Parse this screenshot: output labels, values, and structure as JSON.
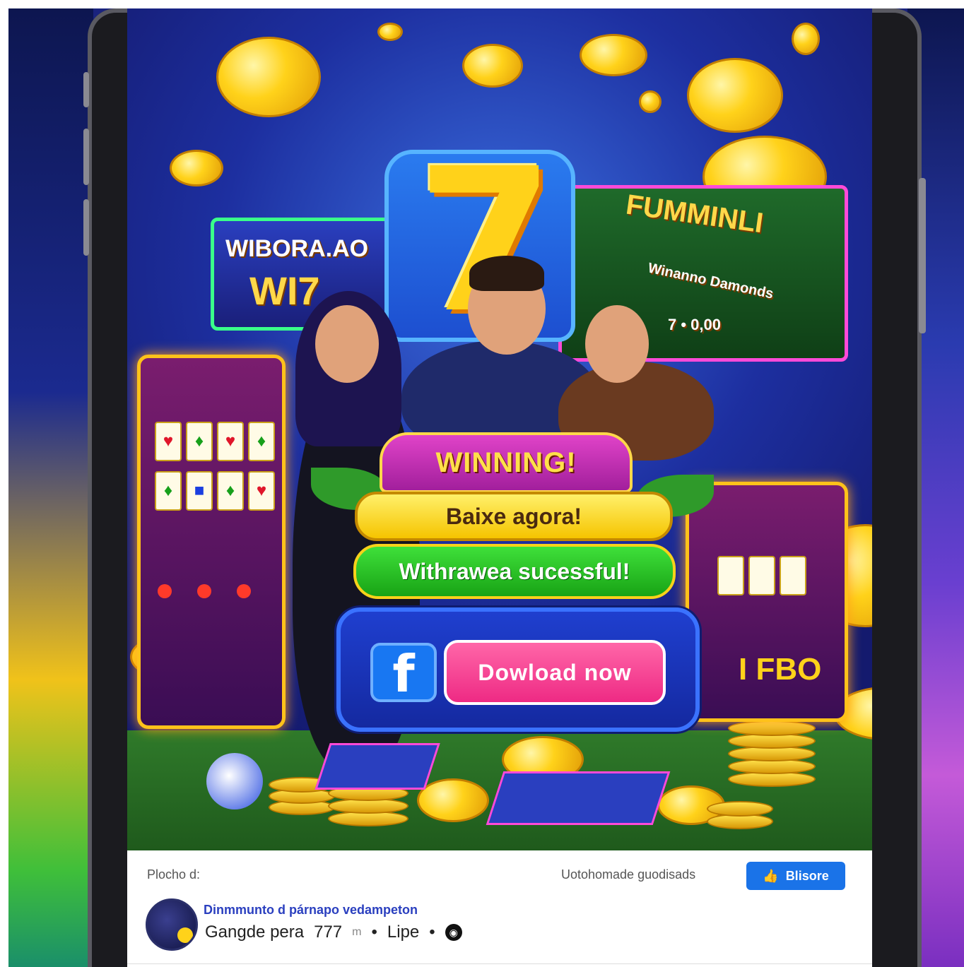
{
  "art": {
    "sign_left_line1": "WIBORA.AO",
    "sign_left_line2": "WI7",
    "sign_right_line1": "FUMMINLI",
    "sign_right_line2": "Winanno Damonds",
    "sign_right_small": "7 • 0,00",
    "sign_slot_right": "I FBO",
    "big_seven": "7"
  },
  "ad": {
    "winning_label": "WINNING!",
    "cta_primary": "Baixe agora!",
    "status_message": "Withrawea sucessful!",
    "download_label": "Dowload now",
    "fb_icon": "facebook-f-icon"
  },
  "post": {
    "sponsored_label": "Plocho d:",
    "right_note": "Uotohomade guodisads",
    "like_button_label": "Blisore",
    "like_icon": "thumbs-up-icon",
    "page_name": "Dinmmunto d párnapo vedampeton",
    "meta_text": "Gangde pera",
    "meta_number": "777",
    "meta_unit": "m",
    "meta_sep": "•",
    "meta_type": "Lipe",
    "globe_icon": "globe-icon"
  },
  "colors": {
    "facebook_blue": "#1877f2",
    "download_pink": "#ee2a84",
    "success_green": "#18a315",
    "cta_yellow": "#f5c400",
    "banner_magenta": "#a21f9c"
  }
}
